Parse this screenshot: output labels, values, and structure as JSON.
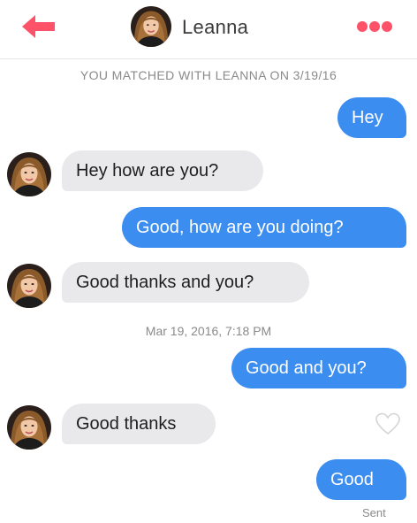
{
  "header": {
    "name": "Leanna"
  },
  "conversation": {
    "match_banner": "YOU MATCHED WITH LEANNA ON 3/19/16",
    "timestamp": "Mar 19, 2016, 7:18 PM",
    "messages": [
      {
        "sender": "me",
        "text": "Hey"
      },
      {
        "sender": "match",
        "text": "Hey how are you?"
      },
      {
        "sender": "me",
        "text": "Good, how are you doing?"
      },
      {
        "sender": "match",
        "text": "Good thanks and you?"
      },
      {
        "sender": "me",
        "text": "Good and you?"
      },
      {
        "sender": "match",
        "text": "Good thanks"
      },
      {
        "sender": "me",
        "text": "Good"
      }
    ],
    "sent_label": "Sent"
  },
  "colors": {
    "accent": "#fe5268",
    "outgoing_bubble": "#3c8df0",
    "incoming_bubble": "#e9e9ec"
  },
  "icons": {
    "back": "back-arrow-icon",
    "more": "more-dots-icon",
    "like": "heart-icon"
  }
}
